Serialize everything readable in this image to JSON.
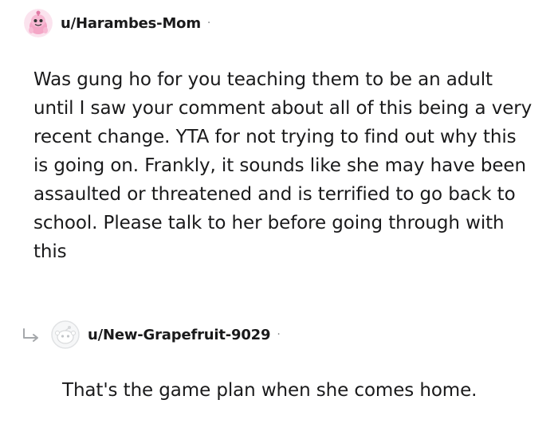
{
  "comment": {
    "username": "u/Harambes-Mom",
    "separator": "·",
    "avatar_icon": "snoo-pink-avatar-icon",
    "body": "Was gung ho for you teaching them to be an adult until I saw your comment about all of this being a very recent change. YTA for not trying to find out why this is going on. Frankly, it sounds like she may have been assaulted or threatened and is terrified to go back to school. Please talk to her before going through with this"
  },
  "reply": {
    "username": "u/New-Grapefruit-9029",
    "separator": "·",
    "avatar_icon": "default-snoo-avatar-icon",
    "reply_icon": "reply-arrow-icon",
    "body": "That's the game plan when she comes home."
  },
  "colors": {
    "text": "#1a1a1b",
    "meta": "#878a8c",
    "avatar_pink": "#f4a6c6",
    "avatar_gray": "#e8eaec"
  }
}
